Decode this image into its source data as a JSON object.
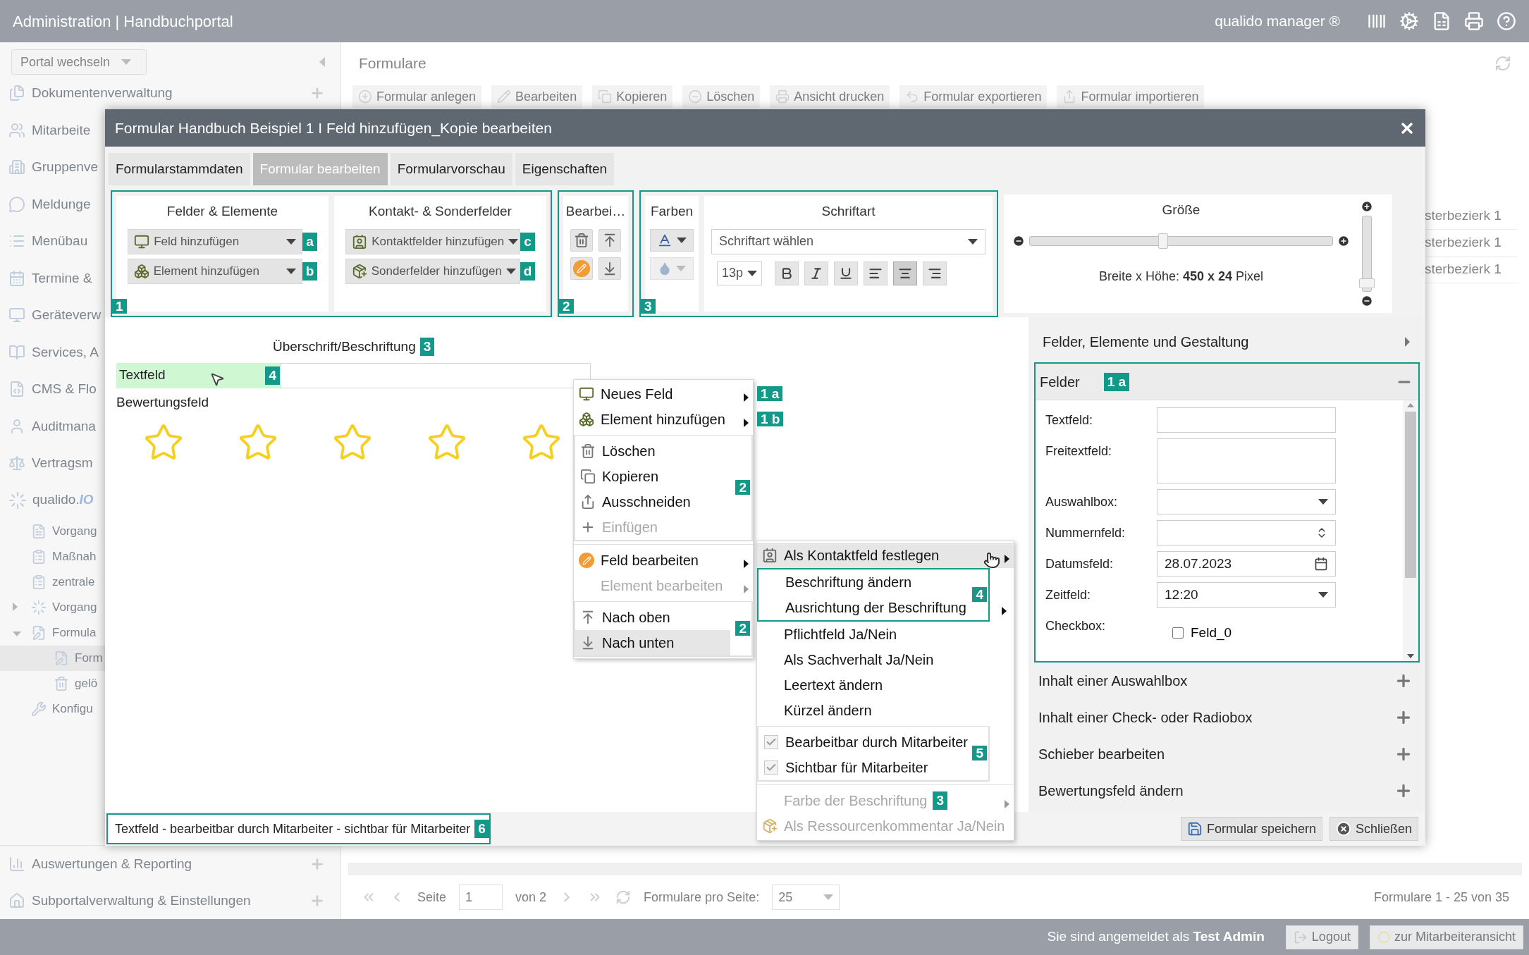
{
  "header": {
    "title": "Administration | Handbuchportal",
    "product": "qualido manager ®"
  },
  "sidebar": {
    "portal_select": "Portal wechseln",
    "items": [
      {
        "label": "Dokumentenverwaltung",
        "expandable": true
      },
      {
        "label": "Mitarbeite"
      },
      {
        "label": "Gruppenve"
      },
      {
        "label": "Meldunge"
      },
      {
        "label": "Menübau"
      },
      {
        "label": "Termine &"
      },
      {
        "label": "Geräteverw"
      },
      {
        "label": "Services, A"
      },
      {
        "label": "CMS & Flo"
      },
      {
        "label": "Auditmana"
      },
      {
        "label": "Vertragsm"
      }
    ],
    "tree": [
      {
        "label": "qualido.",
        "suffix": "IO",
        "children": [
          {
            "label": "Vorgang"
          },
          {
            "label": "Maßnah"
          },
          {
            "label": "zentrale"
          },
          {
            "label": "Vorgang",
            "expanded": false
          },
          {
            "label": "Formula",
            "expanded": true,
            "children": [
              {
                "label": "Form",
                "selected": true
              },
              {
                "label": "gelö",
                "selected": false
              }
            ]
          },
          {
            "label": "Konfigu"
          }
        ]
      }
    ],
    "bottom_items": [
      {
        "label": "Auswertungen & Reporting",
        "expandable": true
      },
      {
        "label": "Subportalverwaltung & Einstellungen",
        "expandable": true
      }
    ]
  },
  "main": {
    "title": "Formulare",
    "toolbar": [
      {
        "label": "Formular anlegen"
      },
      {
        "label": "Bearbeiten"
      },
      {
        "label": "Kopieren"
      },
      {
        "label": "Löschen"
      },
      {
        "label": "Ansicht drucken"
      },
      {
        "label": "Formular exportieren"
      },
      {
        "label": "Formular importieren"
      }
    ],
    "column_cells": [
      "sterbezierk 1",
      "sterbezierk 1",
      "sterbezierk 1"
    ],
    "pager": {
      "page_label": "Seite",
      "page": "1",
      "of": "von 2",
      "per_page_label": "Formulare pro Seite:",
      "per_page": "25",
      "summary": "Formulare 1 - 25 von 35"
    }
  },
  "footer": {
    "login_text": "Sie sind angemeldet als **Test Admin**",
    "logout": "Logout",
    "employee_view": "zur Mitarbeiteransicht"
  },
  "dialog": {
    "title": "Formular Handbuch Beispiel 1 I Feld hinzufügen_Kopie bearbeiten",
    "tabs": [
      {
        "label": "Formularstammdaten",
        "selected": false
      },
      {
        "label": "Formular bearbeiten",
        "selected": true
      },
      {
        "label": "Formularvorschau",
        "selected": false
      },
      {
        "label": "Eigenschaften",
        "selected": false
      }
    ],
    "ribbon": {
      "fields": {
        "badge": "1",
        "panels": [
          {
            "title": "Felder & Elemente",
            "buttons": [
              {
                "label": "Feld hinzufügen",
                "badge": "a"
              },
              {
                "label": "Element hinzufügen",
                "badge": "b"
              }
            ]
          },
          {
            "title": "Kontakt- & Sonderfelder",
            "buttons": [
              {
                "label": "Kontaktfelder hinzufügen",
                "badge": "c"
              },
              {
                "label": "Sonderfelder hinzufügen",
                "badge": "d"
              }
            ]
          }
        ]
      },
      "edit": {
        "title": "Bearbei…",
        "badge": "2"
      },
      "format": {
        "badge": "3",
        "colors_title": "Farben",
        "font_title": "Schriftart",
        "font_select": "Schriftart wählen",
        "size_select": "13p",
        "styles": [
          {
            "kind": "bold",
            "selected": false
          },
          {
            "kind": "italic",
            "selected": false
          },
          {
            "kind": "underline",
            "selected": false
          },
          {
            "kind": "align-left",
            "selected": false
          },
          {
            "kind": "align-center",
            "selected": true
          },
          {
            "kind": "align-right",
            "selected": false
          }
        ]
      },
      "size": {
        "title": "Größe",
        "level": 0.44,
        "dims": "Breite x Höhe: **450 x 24** Pixel",
        "height_slider": {
          "level": 0.08
        }
      }
    },
    "canvas": {
      "heading": "Überschrift/Beschriftung",
      "heading_badge": "3",
      "field": {
        "label": "Textfeld",
        "badge": "4",
        "highlighted": true
      },
      "rating": {
        "label": "Bewertungsfeld",
        "stars": 0
      }
    },
    "context_menu": [
      {
        "separated": false,
        "items": [
          {
            "label": "Neues Feld",
            "submenu": true,
            "disabled": false,
            "highlighted": false,
            "badge": "1 a"
          },
          {
            "label": "Element hinzufügen",
            "submenu": true,
            "disabled": false,
            "highlighted": false,
            "badge": "1 b"
          }
        ]
      },
      {
        "separated": true,
        "frame": "2",
        "items": [
          {
            "label": "Löschen",
            "submenu": false,
            "disabled": false,
            "highlighted": false
          },
          {
            "label": "Kopieren",
            "submenu": false,
            "disabled": false,
            "highlighted": false
          },
          {
            "label": "Ausschneiden",
            "submenu": false,
            "disabled": false,
            "highlighted": false
          },
          {
            "label": "Einfügen",
            "submenu": false,
            "disabled": true,
            "highlighted": false
          }
        ]
      },
      {
        "separated": true,
        "items": [
          {
            "label": "Feld bearbeiten",
            "submenu": true,
            "disabled": false,
            "highlighted": false
          },
          {
            "label": "Element bearbeiten",
            "submenu": true,
            "disabled": true,
            "highlighted": false
          }
        ]
      },
      {
        "separated": true,
        "frame": "2",
        "items": [
          {
            "label": "Nach oben",
            "submenu": false,
            "disabled": false,
            "highlighted": false
          },
          {
            "label": "Nach unten",
            "submenu": false,
            "disabled": false,
            "highlighted": true
          }
        ]
      }
    ],
    "submenu": [
      {
        "separated": false,
        "items": [
          {
            "label": "Als Kontaktfeld festlegen",
            "kind": "action",
            "submenu": true,
            "disabled": false,
            "highlighted": true
          }
        ]
      },
      {
        "separated": false,
        "frame": "4",
        "items": [
          {
            "label": "Beschriftung ändern",
            "kind": "action",
            "submenu": false,
            "disabled": false,
            "highlighted": false
          },
          {
            "label": "Ausrichtung der Beschriftung",
            "kind": "action",
            "submenu": true,
            "disabled": false,
            "highlighted": false
          }
        ]
      },
      {
        "separated": false,
        "items": [
          {
            "label": "Pflichtfeld Ja/Nein",
            "kind": "action",
            "submenu": false,
            "disabled": false,
            "highlighted": false
          },
          {
            "label": "Als Sachverhalt Ja/Nein",
            "kind": "action",
            "submenu": false,
            "disabled": false,
            "highlighted": false
          },
          {
            "label": "Leertext ändern",
            "kind": "action",
            "submenu": false,
            "disabled": false,
            "highlighted": false
          },
          {
            "label": "Kürzel ändern",
            "kind": "action",
            "submenu": false,
            "disabled": false,
            "highlighted": false
          }
        ]
      },
      {
        "separated": true,
        "frame": "5",
        "items": [
          {
            "label": "Bearbeitbar durch Mitarbeiter",
            "kind": "check",
            "checked": true,
            "submenu": false,
            "disabled": false,
            "highlighted": false
          },
          {
            "label": "Sichtbar für Mitarbeiter",
            "kind": "check",
            "checked": true,
            "submenu": false,
            "disabled": false,
            "highlighted": false
          }
        ]
      },
      {
        "separated": true,
        "items": [
          {
            "label": "Farbe der Beschriftung",
            "kind": "action",
            "inline_badge": "3",
            "submenu": true,
            "disabled": true,
            "highlighted": false
          },
          {
            "label": "Als Ressourcenkommentar Ja/Nein",
            "kind": "action",
            "submenu": false,
            "disabled": true,
            "highlighted": false
          }
        ]
      }
    ],
    "panel": {
      "sections": [
        {
          "title": "Felder, Elemente und Gestaltung",
          "kind": "group",
          "expanded": false
        },
        {
          "title": "Felder",
          "kind": "section",
          "expanded": true,
          "badge": "1 a",
          "fields": [
            {
              "label": "Textfeld:",
              "kind": "text"
            },
            {
              "label": "Freitextfeld:",
              "kind": "textarea"
            },
            {
              "label": "Auswahlbox:",
              "kind": "select"
            },
            {
              "label": "Nummernfeld:",
              "kind": "number"
            },
            {
              "label": "Datumsfeld:",
              "kind": "date",
              "value": "28.07.2023"
            },
            {
              "label": "Zeitfeld:",
              "kind": "select",
              "value": "12:20"
            },
            {
              "label": "Checkbox:",
              "kind": "checkbox",
              "option": "Feld_0",
              "checked": false
            }
          ]
        },
        {
          "title": "Inhalt einer Auswahlbox",
          "kind": "section",
          "expanded": false
        },
        {
          "title": "Inhalt einer Check- oder Radiobox",
          "kind": "section",
          "expanded": false
        },
        {
          "title": "Schieber bearbeiten",
          "kind": "section",
          "expanded": false
        },
        {
          "title": "Bewertungsfeld ändern",
          "kind": "section",
          "expanded": false
        }
      ]
    },
    "status": {
      "text": "Textfeld - bearbeitbar durch Mitarbeiter - sichtbar für Mitarbeiter",
      "badge": "6"
    },
    "buttons": [
      {
        "label": "Formular speichern"
      },
      {
        "label": "Schließen"
      }
    ]
  }
}
